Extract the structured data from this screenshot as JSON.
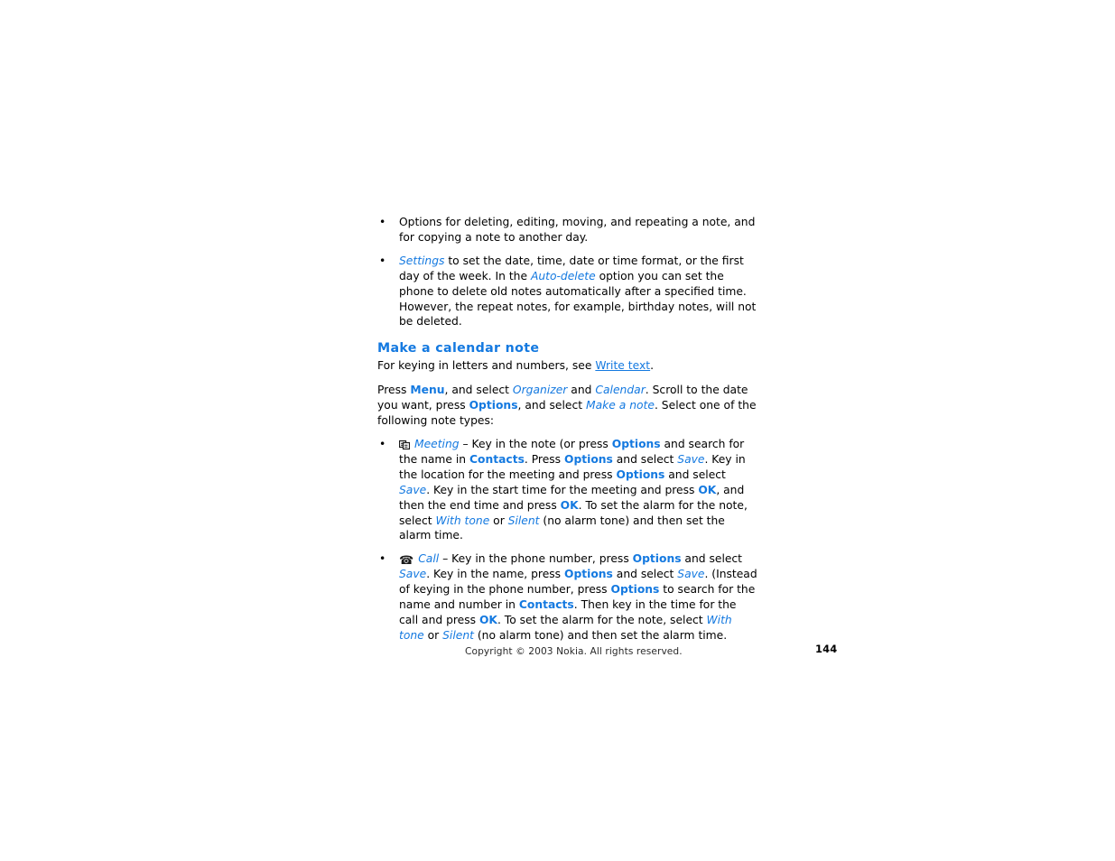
{
  "document": {
    "type": "user-guide-page",
    "accent_color": "#1479e0",
    "text_color": "#000000",
    "background_color": "#ffffff"
  },
  "bullets_top": [
    {
      "name": "bullet-options-note-actions",
      "runs": [
        {
          "style": "plain",
          "text": "Options for deleting, editing, moving, and repeating a note, and for copying a note to another day."
        }
      ]
    },
    {
      "name": "bullet-settings",
      "runs": [
        {
          "style": "italic-blue",
          "text": "Settings"
        },
        {
          "style": "plain",
          "text": " to set the date, time, date or time format, or the first day of the week. In the "
        },
        {
          "style": "italic-blue",
          "text": "Auto-delete"
        },
        {
          "style": "plain",
          "text": " option you can set the phone to delete old notes automatically after a specified time. However, the repeat notes, for example, birthday notes, will not be deleted."
        }
      ]
    }
  ],
  "heading": {
    "text": "Make a calendar note"
  },
  "intro_paragraph": {
    "runs": [
      {
        "style": "plain",
        "text": "For keying in letters and numbers, see "
      },
      {
        "style": "link",
        "text": "Write text"
      },
      {
        "style": "plain",
        "text": "."
      }
    ]
  },
  "steps_paragraph": {
    "runs": [
      {
        "style": "plain",
        "text": "Press "
      },
      {
        "style": "key",
        "text": "Menu"
      },
      {
        "style": "plain",
        "text": ", and select "
      },
      {
        "style": "italic-blue",
        "text": "Organizer"
      },
      {
        "style": "plain",
        "text": " and "
      },
      {
        "style": "italic-blue",
        "text": "Calendar"
      },
      {
        "style": "plain",
        "text": ". Scroll to the date you want, press "
      },
      {
        "style": "key",
        "text": "Options"
      },
      {
        "style": "plain",
        "text": ", and select "
      },
      {
        "style": "italic-blue",
        "text": "Make a note"
      },
      {
        "style": "plain",
        "text": ". Select one of the following note types:"
      }
    ]
  },
  "note_types": [
    {
      "name": "bullet-note-type-meeting",
      "icon": "meeting-icon",
      "runs": [
        {
          "style": "italic-blue",
          "text": "Meeting"
        },
        {
          "style": "plain",
          "text": " – Key in the note (or press "
        },
        {
          "style": "key",
          "text": "Options"
        },
        {
          "style": "plain",
          "text": " and search for the name in "
        },
        {
          "style": "key",
          "text": "Contacts"
        },
        {
          "style": "plain",
          "text": ". Press "
        },
        {
          "style": "key",
          "text": "Options"
        },
        {
          "style": "plain",
          "text": " and select "
        },
        {
          "style": "italic-blue",
          "text": "Save"
        },
        {
          "style": "plain",
          "text": ". Key in the location for the meeting and press "
        },
        {
          "style": "key",
          "text": "Options"
        },
        {
          "style": "plain",
          "text": " and select "
        },
        {
          "style": "italic-blue",
          "text": "Save"
        },
        {
          "style": "plain",
          "text": ". Key in the start time for the meeting and press "
        },
        {
          "style": "key",
          "text": "OK"
        },
        {
          "style": "plain",
          "text": ", and then the end time and press "
        },
        {
          "style": "key",
          "text": "OK"
        },
        {
          "style": "plain",
          "text": ". To set the alarm for the note, select "
        },
        {
          "style": "italic-blue",
          "text": "With tone"
        },
        {
          "style": "plain",
          "text": " or "
        },
        {
          "style": "italic-blue",
          "text": "Silent"
        },
        {
          "style": "plain",
          "text": " (no alarm tone) and then set the alarm time."
        }
      ]
    },
    {
      "name": "bullet-note-type-call",
      "icon": "telephone-icon",
      "runs": [
        {
          "style": "italic-blue",
          "text": "Call"
        },
        {
          "style": "plain",
          "text": " – Key in the phone number, press "
        },
        {
          "style": "key",
          "text": "Options"
        },
        {
          "style": "plain",
          "text": " and select "
        },
        {
          "style": "italic-blue",
          "text": "Save"
        },
        {
          "style": "plain",
          "text": ". Key in the name, press "
        },
        {
          "style": "key",
          "text": "Options"
        },
        {
          "style": "plain",
          "text": " and select "
        },
        {
          "style": "italic-blue",
          "text": "Save"
        },
        {
          "style": "plain",
          "text": ". (Instead of keying in the phone number, press "
        },
        {
          "style": "key",
          "text": "Options"
        },
        {
          "style": "plain",
          "text": " to search for the name and number in "
        },
        {
          "style": "key",
          "text": "Contacts"
        },
        {
          "style": "plain",
          "text": ". Then key in the time for the call and press "
        },
        {
          "style": "key",
          "text": "OK"
        },
        {
          "style": "plain",
          "text": ". To set the alarm for the note, select "
        },
        {
          "style": "italic-blue",
          "text": "With tone"
        },
        {
          "style": "plain",
          "text": " or "
        },
        {
          "style": "italic-blue",
          "text": "Silent"
        },
        {
          "style": "plain",
          "text": " (no alarm tone) and then set the alarm time."
        }
      ]
    }
  ],
  "bullet_marker": "•",
  "footer": {
    "copyright": "Copyright © 2003 Nokia. All rights reserved.",
    "page_number": "144"
  }
}
